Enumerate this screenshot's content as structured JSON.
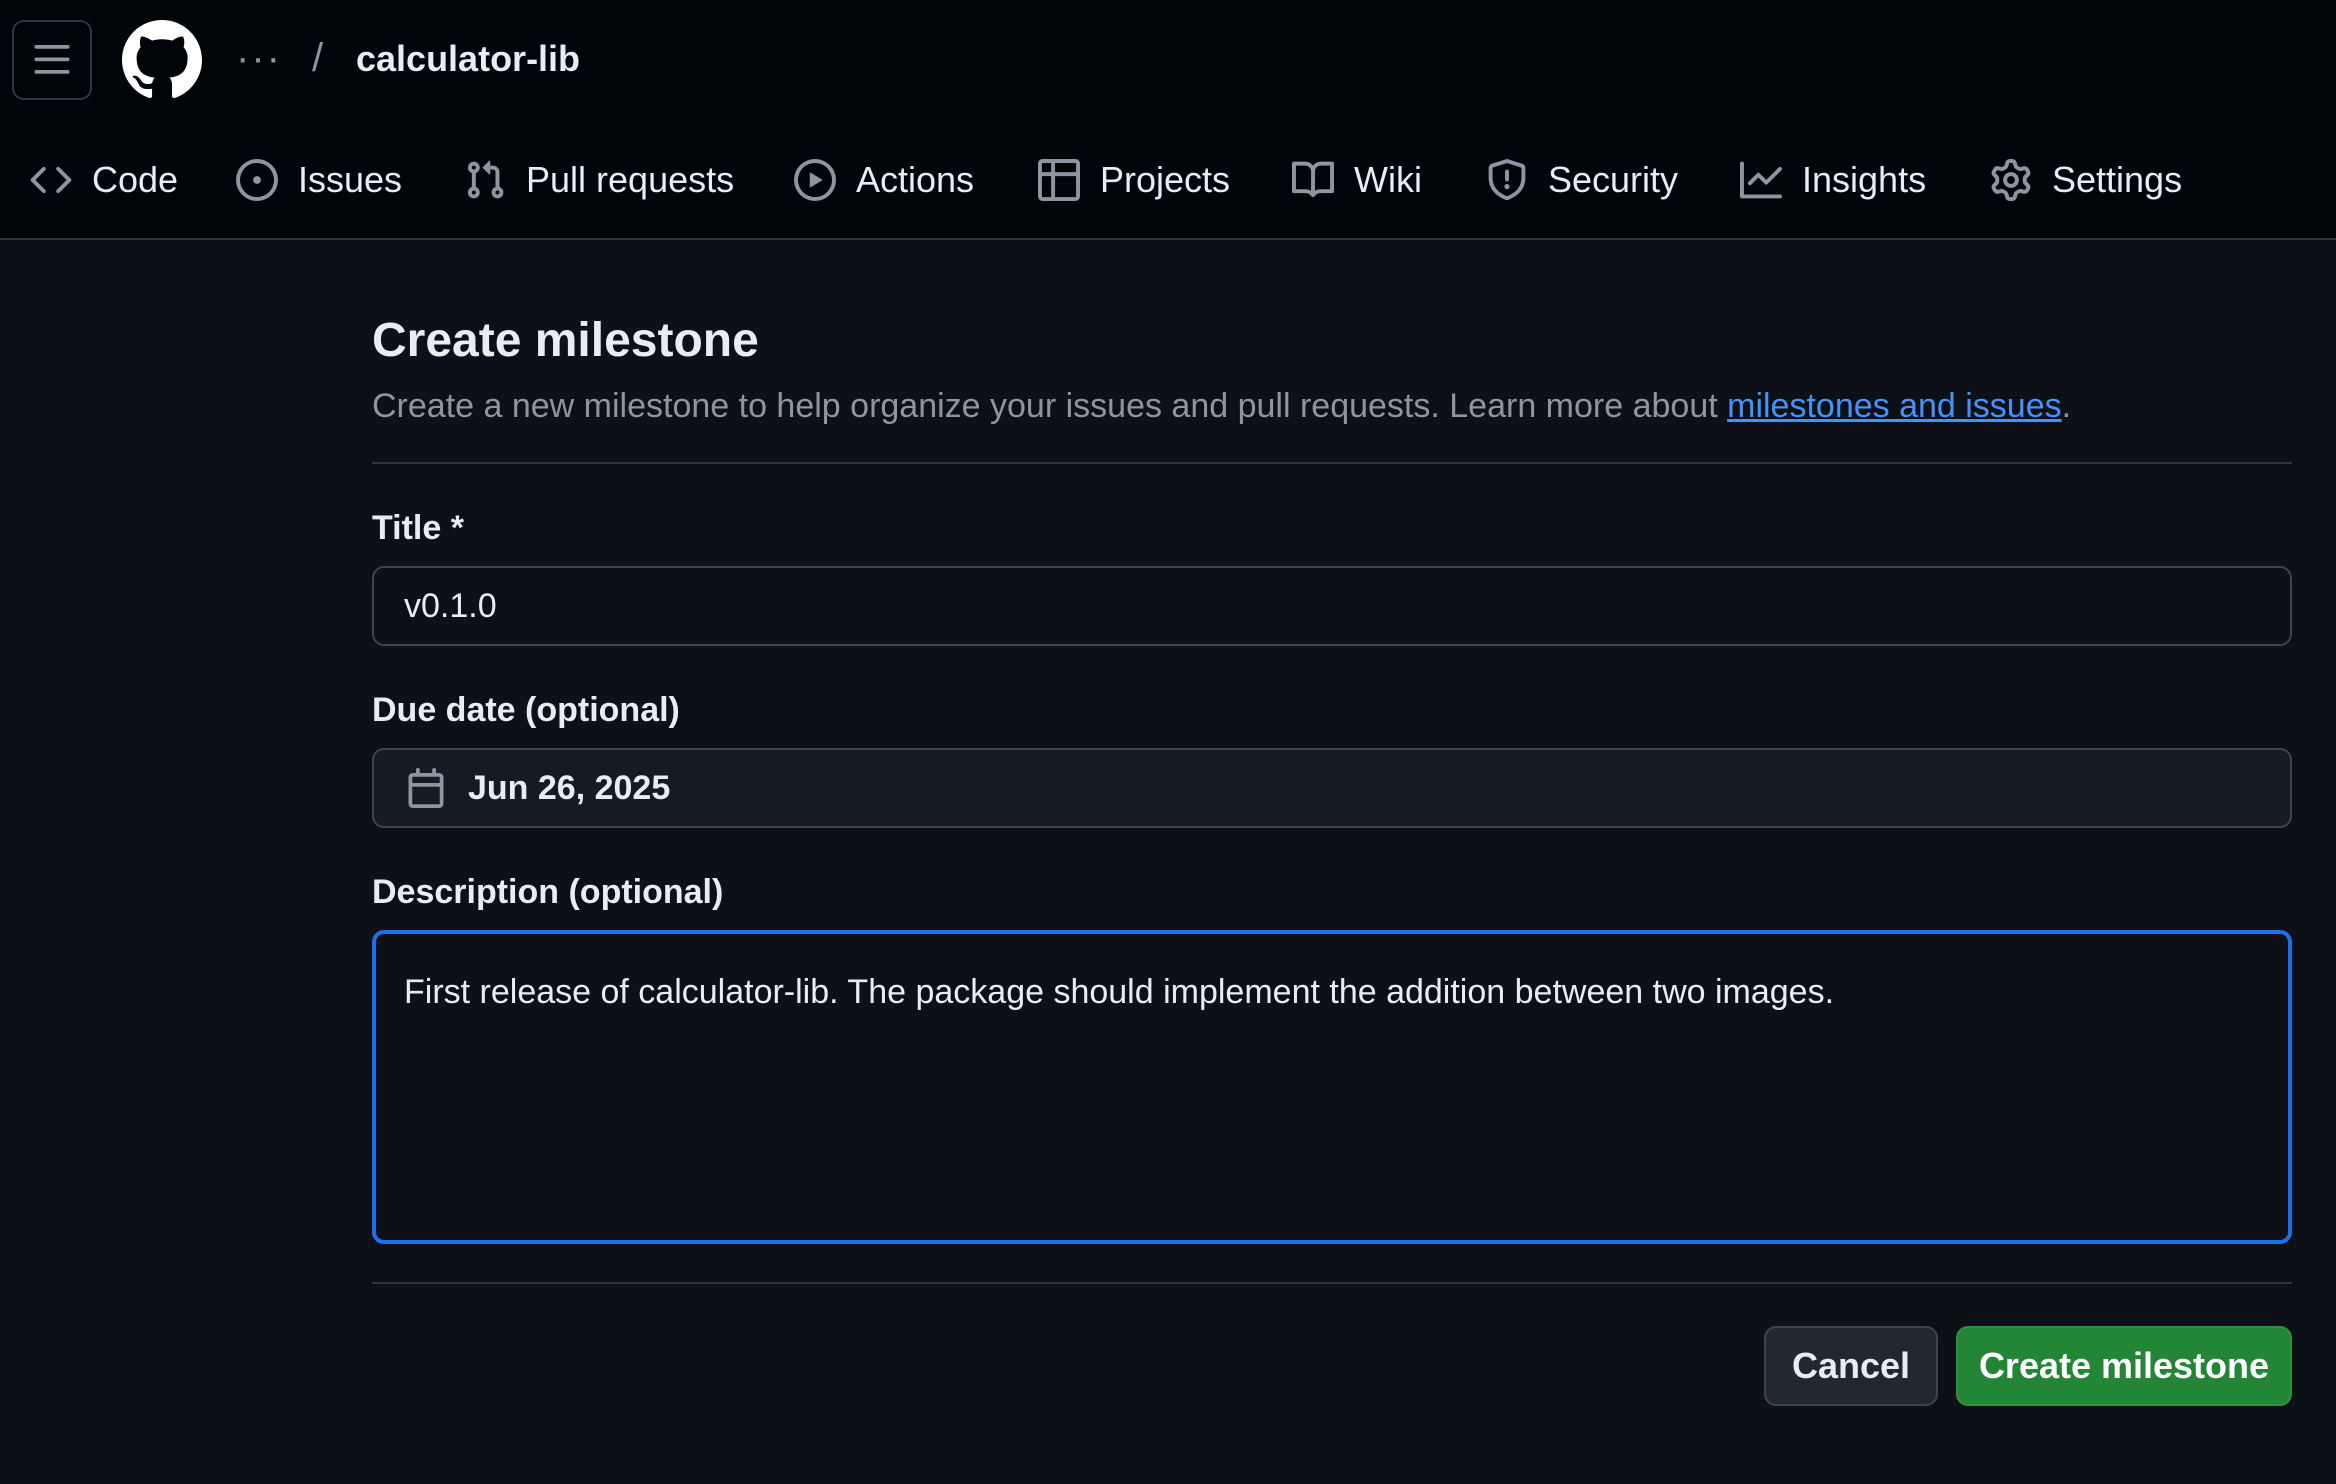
{
  "header": {
    "breadcrumb_dots": "···",
    "breadcrumb_separator": "/",
    "repo_name": "calculator-lib",
    "tabs": [
      {
        "label": "Code",
        "icon": "code-icon"
      },
      {
        "label": "Issues",
        "icon": "issue-opened-icon"
      },
      {
        "label": "Pull requests",
        "icon": "git-pull-request-icon"
      },
      {
        "label": "Actions",
        "icon": "play-icon"
      },
      {
        "label": "Projects",
        "icon": "table-icon"
      },
      {
        "label": "Wiki",
        "icon": "book-icon"
      },
      {
        "label": "Security",
        "icon": "shield-icon"
      },
      {
        "label": "Insights",
        "icon": "graph-icon"
      },
      {
        "label": "Settings",
        "icon": "gear-icon"
      }
    ]
  },
  "form": {
    "title": "Create milestone",
    "subtitle_prefix": "Create a new milestone to help organize your issues and pull requests. Learn more about ",
    "subtitle_link": "milestones and issues",
    "subtitle_suffix": ".",
    "title_label": "Title *",
    "title_value": "v0.1.0",
    "due_date_label": "Due date (optional)",
    "due_date_value": "Jun 26, 2025",
    "description_label": "Description (optional)",
    "description_value": "First release of calculator-lib. The package should implement the addition between two images.",
    "cancel_label": "Cancel",
    "create_label": "Create milestone"
  },
  "colors": {
    "background": "#0d1117",
    "header_background": "#010409",
    "accent_blue": "#1f6feb",
    "link": "#4493f8",
    "primary_green": "#238636"
  }
}
